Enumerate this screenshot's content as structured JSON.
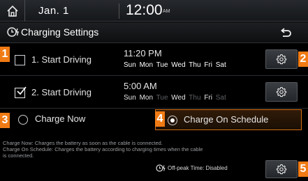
{
  "status": {
    "date": "Jan.  1",
    "time": "12:00",
    "ampm": "AM"
  },
  "header": {
    "title": "Charging Settings"
  },
  "schedules": [
    {
      "label": "1. Start Driving",
      "checked": false,
      "time": "11:20 PM",
      "days": [
        {
          "name": "Sun",
          "active": true
        },
        {
          "name": "Mon",
          "active": true
        },
        {
          "name": "Tue",
          "active": true
        },
        {
          "name": "Wed",
          "active": true
        },
        {
          "name": "Thu",
          "active": true
        },
        {
          "name": "Fri",
          "active": true
        },
        {
          "name": "Sat",
          "active": true
        }
      ]
    },
    {
      "label": "2. Start Driving",
      "checked": true,
      "time": "5:00 AM",
      "days": [
        {
          "name": "Sun",
          "active": true
        },
        {
          "name": "Mon",
          "active": true
        },
        {
          "name": "Tue",
          "active": false
        },
        {
          "name": "Wed",
          "active": true
        },
        {
          "name": "Thu",
          "active": false
        },
        {
          "name": "Fri",
          "active": true
        },
        {
          "name": "Sat",
          "active": false
        }
      ]
    }
  ],
  "modes": {
    "charge_now": "Charge Now",
    "charge_on_schedule": "Charge On Schedule",
    "selected": "charge_on_schedule"
  },
  "description": {
    "line1": "Charge Now: Charges the battery as soon as the cable is connected.",
    "line2": "Charge On Schedule: Charges the battery according to charging times when the cable",
    "line3": "is connected."
  },
  "offpeak": {
    "label": "Off-peak Time: Disabled"
  },
  "badges": [
    "1",
    "2",
    "3",
    "4",
    "5"
  ],
  "colors": {
    "accent": "#f07b14",
    "background": "#000000",
    "inactive_day": "#5d6064"
  }
}
